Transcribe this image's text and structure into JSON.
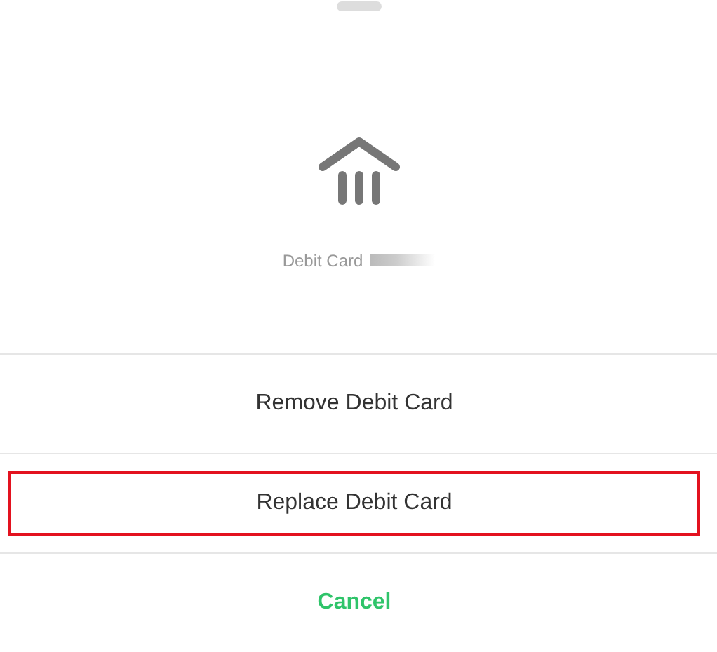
{
  "account": {
    "label": "Debit Card",
    "masked": true
  },
  "actions": [
    {
      "label": "Remove Debit Card",
      "kind": "action",
      "highlighted": false
    },
    {
      "label": "Replace Debit Card",
      "kind": "action",
      "highlighted": true
    },
    {
      "label": "Cancel",
      "kind": "cancel",
      "highlighted": false
    }
  ]
}
